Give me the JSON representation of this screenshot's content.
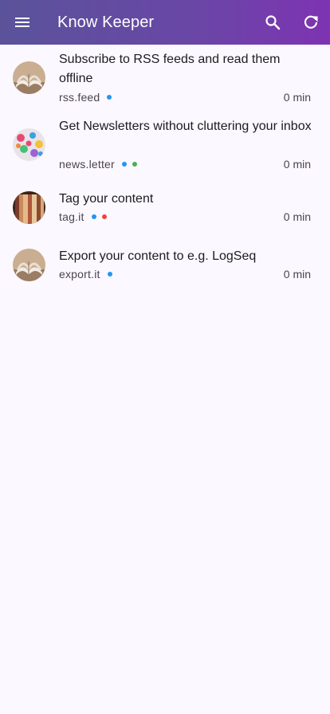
{
  "app_bar": {
    "title": "Know Keeper",
    "menu_icon": "menu-icon",
    "search_icon": "search-icon",
    "refresh_icon": "refresh-icon"
  },
  "colors": {
    "app_bar_start": "#5a539a",
    "app_bar_end": "#7e33b2",
    "tag_blue": "#2196f3",
    "tag_green": "#4caf50",
    "tag_red": "#f44336"
  },
  "items": [
    {
      "title": "Subscribe to RSS feeds and read them offline",
      "source": "rss.feed",
      "read_time": "0 min",
      "tags": [
        "blue"
      ],
      "thumbnail": "open-book-image"
    },
    {
      "title": "Get Newsletters without cluttering your inbox",
      "source": "news.letter",
      "read_time": "0 min",
      "tags": [
        "blue",
        "green"
      ],
      "thumbnail": "colorful-letters-image"
    },
    {
      "title": "Tag your content",
      "source": "tag.it",
      "read_time": "0 min",
      "tags": [
        "blue",
        "red"
      ],
      "thumbnail": "books-on-shelf-image"
    },
    {
      "title": "Export your content to e.g. LogSeq",
      "source": "export.it",
      "read_time": "0 min",
      "tags": [
        "blue"
      ],
      "thumbnail": "open-book-image"
    }
  ]
}
